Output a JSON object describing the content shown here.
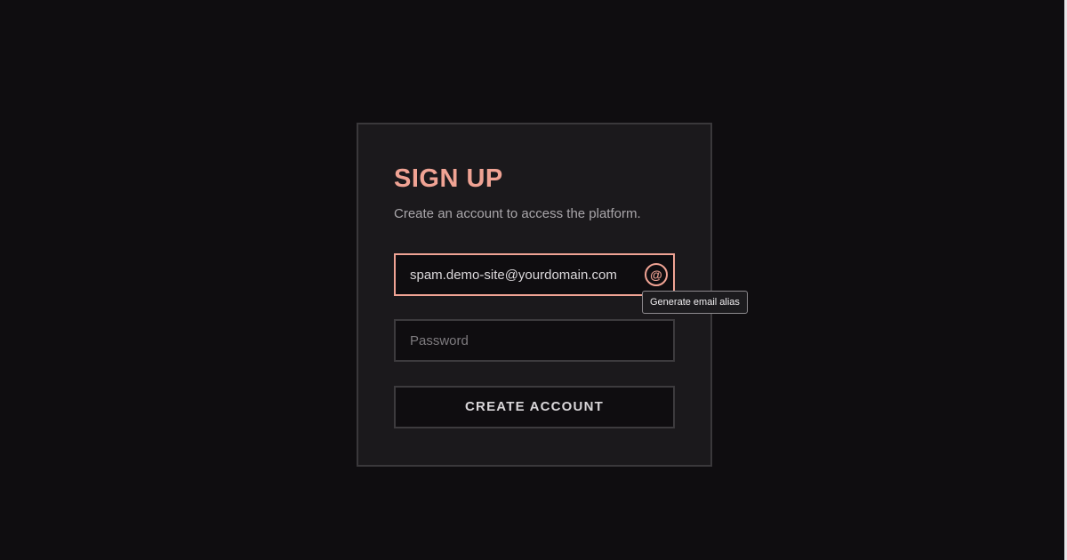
{
  "signup": {
    "title": "SIGN UP",
    "subtitle": "Create an account to access the platform.",
    "email": {
      "value": "spam.demo-site@yourdomain.com",
      "alias_button_glyph": "@",
      "alias_button_icon": "at-sign-icon"
    },
    "password": {
      "placeholder": "Password",
      "value": ""
    },
    "submit_label": "CREATE ACCOUNT"
  },
  "tooltip": {
    "text": "Generate email alias"
  },
  "colors": {
    "background": "#0f0d10",
    "card": "#1b191c",
    "accent": "#f0a394",
    "border": "#3d3b3e"
  }
}
